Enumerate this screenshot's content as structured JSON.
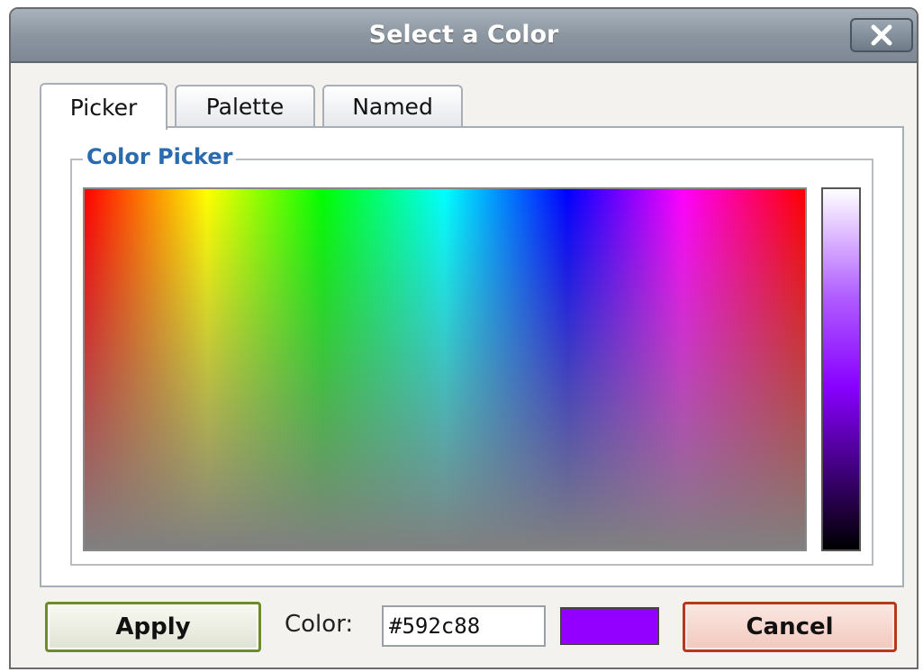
{
  "dialog": {
    "title": "Select a Color",
    "close_icon": "close-icon"
  },
  "tabs": [
    {
      "label": "Picker",
      "active": true
    },
    {
      "label": "Palette",
      "active": false
    },
    {
      "label": "Named",
      "active": false
    }
  ],
  "picker": {
    "group_label": "Color Picker"
  },
  "footer": {
    "apply_label": "Apply",
    "color_label": "Color:",
    "color_value": "#592c88",
    "swatch_color": "#9400ff",
    "cancel_label": "Cancel"
  },
  "colors": {
    "title_bar": "#8b96a1",
    "group_label": "#2a6bb0",
    "apply_border": "#6f8a2a",
    "cancel_border": "#b5391f"
  }
}
